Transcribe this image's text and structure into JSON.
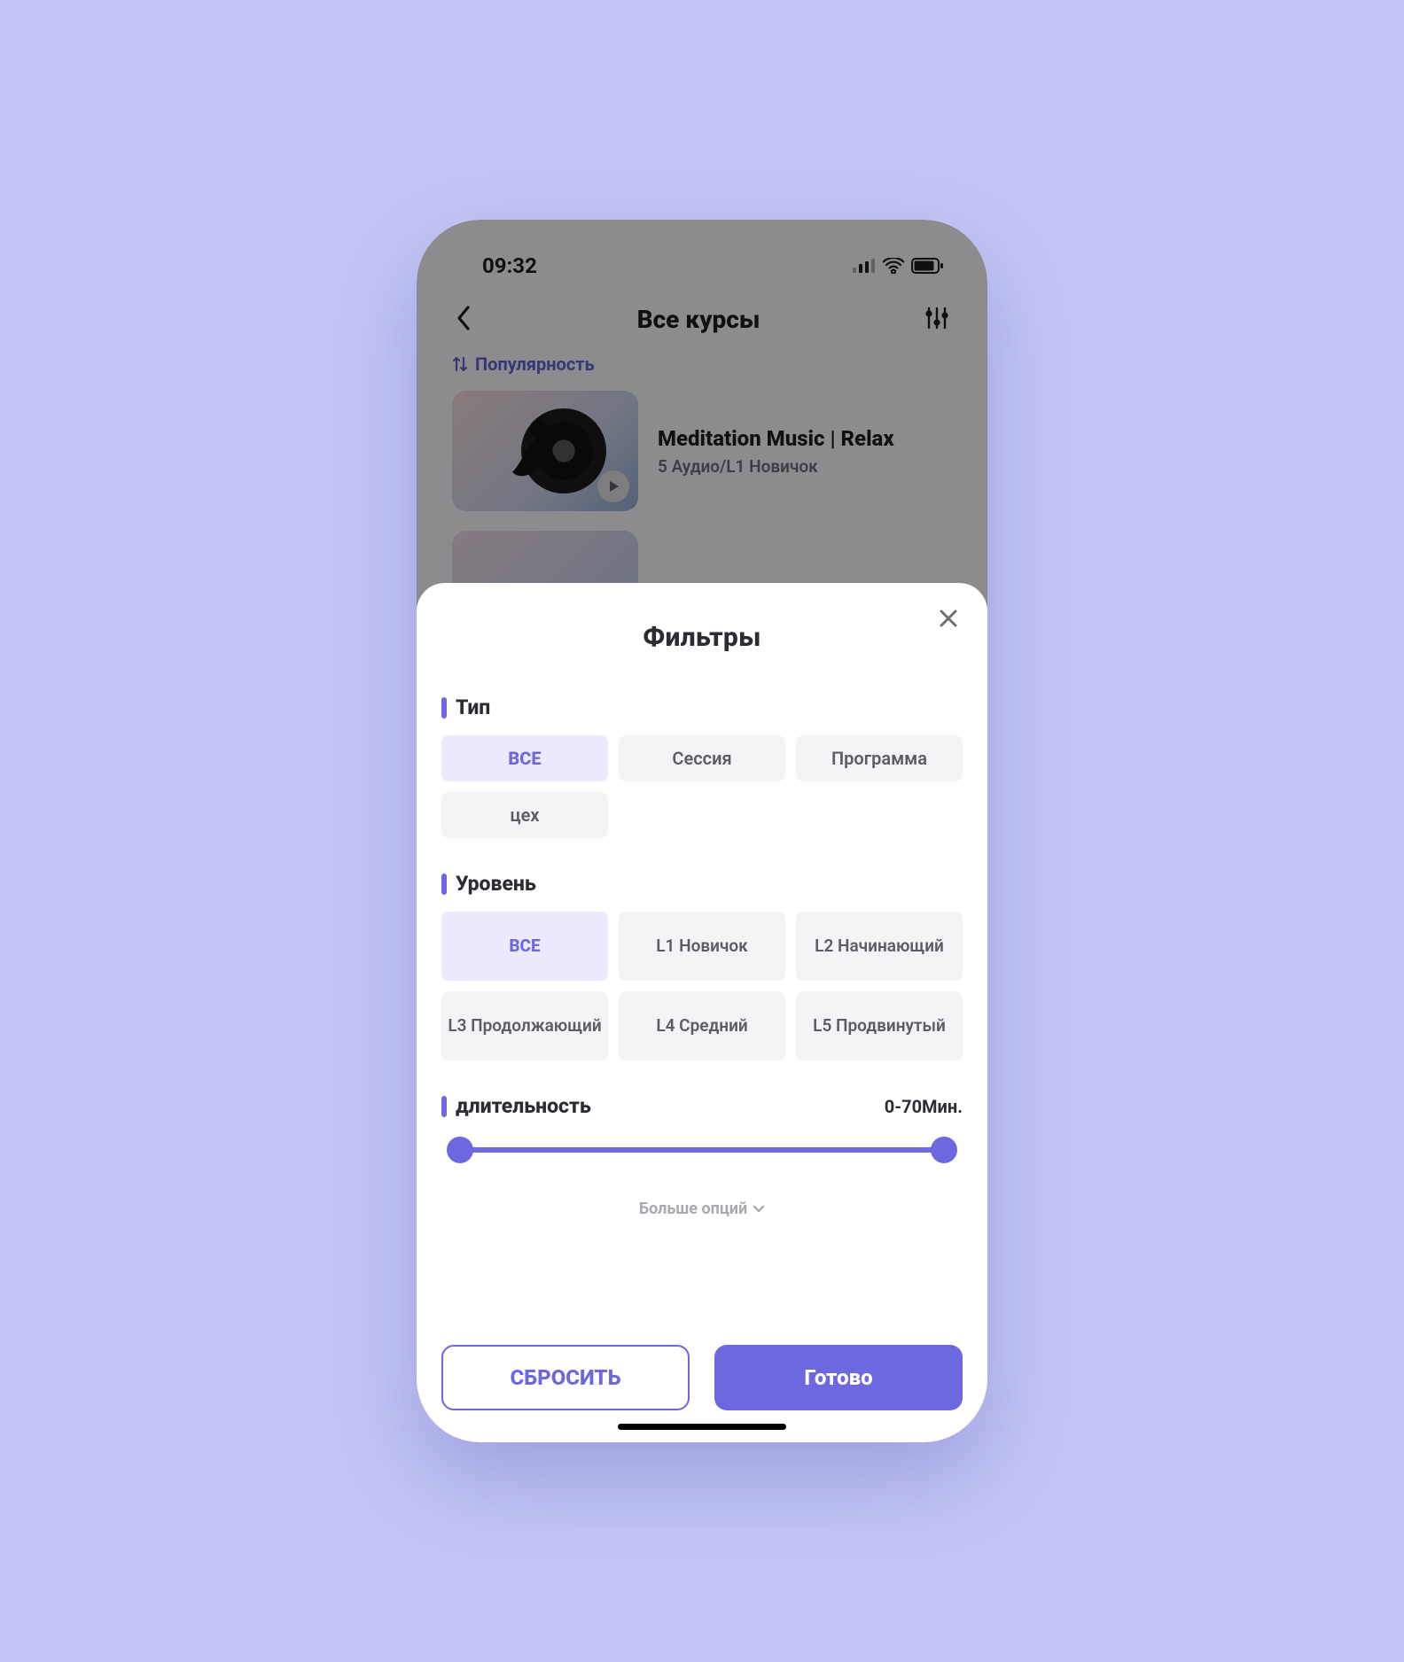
{
  "statusbar": {
    "time": "09:32"
  },
  "header": {
    "title": "Все курсы",
    "sort_label": "Популярность"
  },
  "course": {
    "title": "Meditation Music | Relax",
    "subtitle": "5 Аудио/L1 Новичок"
  },
  "sheet": {
    "title": "Фильтры",
    "sections": {
      "type": {
        "label": "Тип",
        "options": [
          {
            "label": "ВСЕ",
            "active": true
          },
          {
            "label": "Сессия",
            "active": false
          },
          {
            "label": "Программа",
            "active": false
          },
          {
            "label": "цех",
            "active": false
          }
        ]
      },
      "level": {
        "label": "Уровень",
        "options": [
          {
            "label": "ВСЕ",
            "active": true
          },
          {
            "label": "L1 Новичок",
            "active": false
          },
          {
            "label": "L2 Начинающий",
            "active": false
          },
          {
            "label": "L3 Продолжающий",
            "active": false
          },
          {
            "label": "L4 Средний",
            "active": false
          },
          {
            "label": "L5 Продвинутый",
            "active": false
          }
        ]
      },
      "duration": {
        "label": "длительность",
        "value_text": "0-70Мин.",
        "min": 0,
        "max": 70
      }
    },
    "more_options": "Больше опций",
    "reset": "СБРОСИТЬ",
    "done": "Готово"
  }
}
